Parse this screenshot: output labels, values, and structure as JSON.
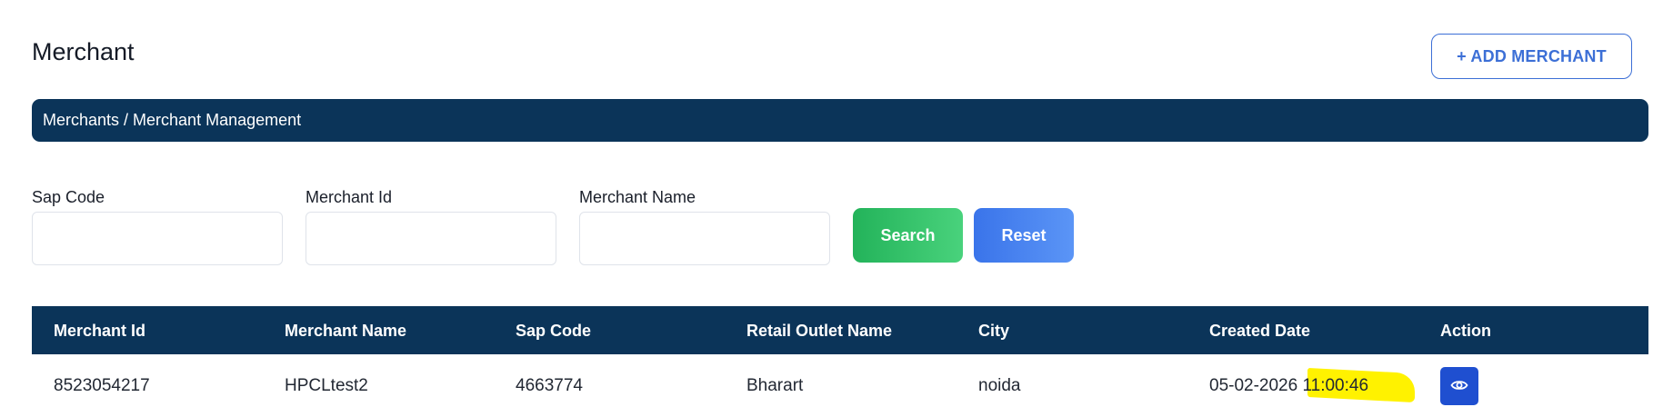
{
  "header": {
    "title": "Merchant",
    "add_button_label": "+ ADD MERCHANT"
  },
  "breadcrumb": {
    "text": "Merchants / Merchant Management"
  },
  "filters": {
    "sap_code": {
      "label": "Sap Code",
      "value": "",
      "placeholder": ""
    },
    "merchant_id": {
      "label": "Merchant Id",
      "value": "",
      "placeholder": ""
    },
    "merchant_name": {
      "label": "Merchant Name",
      "value": "",
      "placeholder": ""
    },
    "search_label": "Search",
    "reset_label": "Reset"
  },
  "table": {
    "columns": [
      "Merchant Id",
      "Merchant Name",
      "Sap Code",
      "Retail Outlet Name",
      "City",
      "Created Date",
      "Action"
    ],
    "rows": [
      {
        "merchant_id": "8523054217",
        "merchant_name": "HPCLtest2",
        "sap_code": "4663774",
        "retail_outlet_name": "Bharart",
        "city": "noida",
        "created_date": "05-02-2026 11:00:46",
        "action_icon": "eye-icon"
      }
    ]
  },
  "colors": {
    "navy": "#0b3459",
    "accent_blue": "#3c6fd6",
    "search_green": "#23b35a",
    "reset_blue": "#3a74ea",
    "view_button": "#1f4fd0",
    "highlight": "#fff200"
  }
}
